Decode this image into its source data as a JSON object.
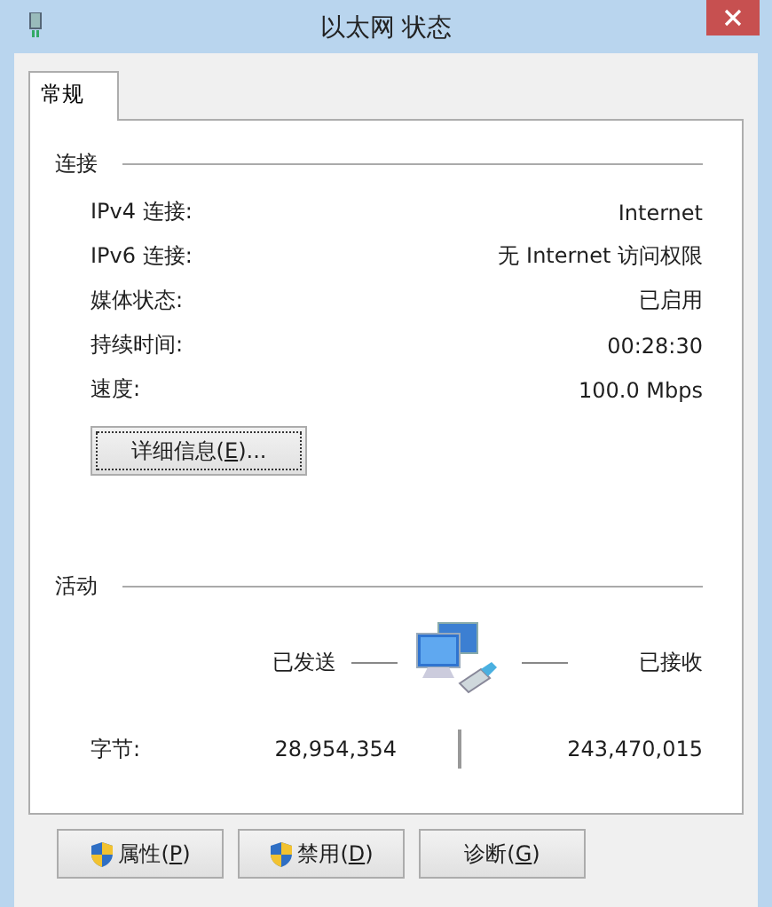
{
  "window": {
    "title": "以太网 状态"
  },
  "tabs": [
    {
      "label": "常规",
      "selected": true
    }
  ],
  "connection": {
    "heading": "连接",
    "rows": [
      {
        "label": "IPv4 连接:",
        "value": "Internet"
      },
      {
        "label": "IPv6 连接:",
        "value": "无 Internet 访问权限"
      },
      {
        "label": "媒体状态:",
        "value": "已启用"
      },
      {
        "label": "持续时间:",
        "value": "00:28:30"
      },
      {
        "label": "速度:",
        "value": "100.0 Mbps"
      }
    ],
    "details_button": {
      "before": "详细信息(",
      "key": "E",
      "after": ")..."
    }
  },
  "activity": {
    "heading": "活动",
    "sent_label": "已发送",
    "received_label": "已接收",
    "bytes_label": "字节:",
    "bytes_sent": "28,954,354",
    "bytes_received": "243,470,015"
  },
  "buttons": [
    {
      "before": "属性(",
      "key": "P",
      "after": ")",
      "shield": true
    },
    {
      "before": "禁用(",
      "key": "D",
      "after": ")",
      "shield": true
    },
    {
      "before": "诊断(",
      "key": "G",
      "after": ")",
      "shield": false
    }
  ]
}
